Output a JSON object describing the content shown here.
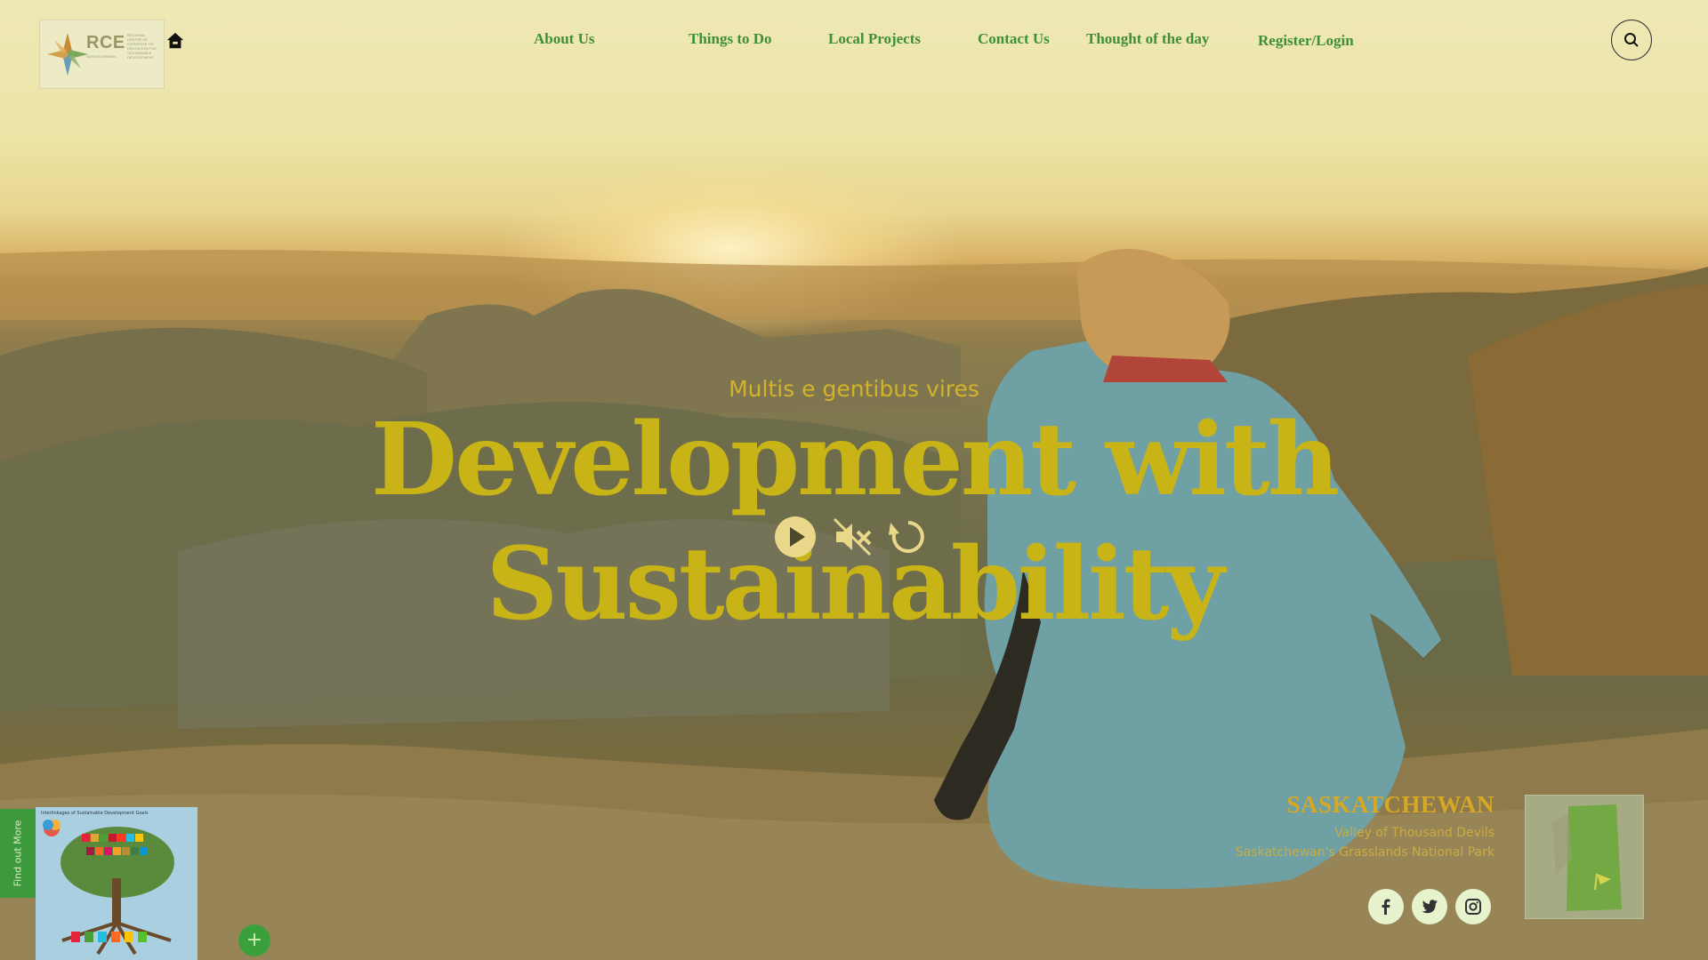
{
  "nav": {
    "logo_text": "RCE",
    "logo_subtext": "SASKATCHEWAN",
    "logo_small_text": "REGIONAL CENTRE OF EXPERTISE ON EDUCATION FOR SUSTAINABLE DEVELOPMENT",
    "items": [
      {
        "label": "About Us"
      },
      {
        "label": "Things to Do"
      },
      {
        "label": "Local Projects"
      },
      {
        "label": "Contact Us"
      },
      {
        "label": "Thought of the day"
      },
      {
        "label": "Register/Login"
      }
    ],
    "home_icon": "home-icon",
    "search_icon": "search-icon"
  },
  "hero": {
    "tagline": "Multis e gentibus vires",
    "headline": "Development with Sustainability",
    "controls": [
      "play-icon",
      "mute-icon",
      "replay-icon"
    ]
  },
  "location": {
    "region": "SASKATCHEWAN",
    "place": "Valley of Thousand Devils",
    "park": "Saskatchewan's Grasslands National Park"
  },
  "social": [
    "facebook-icon",
    "twitter-icon",
    "instagram-icon"
  ],
  "side": {
    "find_out_more": "Find out More",
    "plus": "+",
    "sdg_caption": "Interlinkages of Sustainable Development Goals"
  },
  "colors": {
    "nav_link": "#3f8f3a",
    "headline": "#c9b417",
    "tagline": "#d4b22a",
    "accent_green": "#3c9a3c"
  }
}
